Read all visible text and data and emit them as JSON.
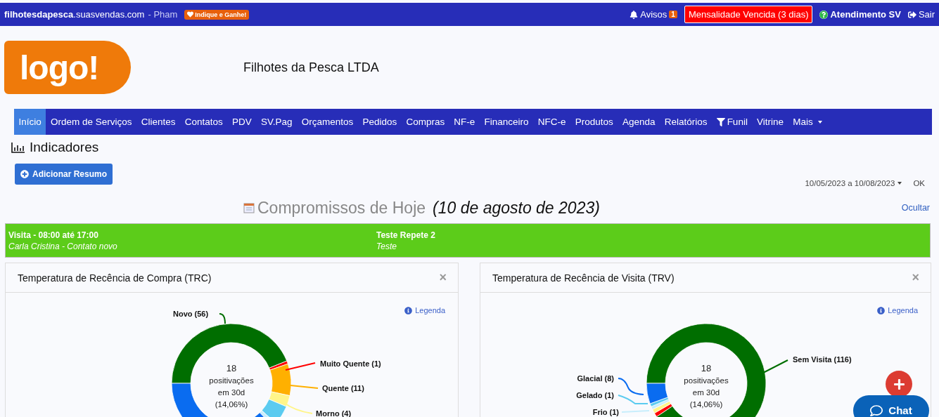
{
  "top_bar": {
    "site": "**filhotesdapesca**.suasvendas.com",
    "user": "- Pham",
    "promo": "Indique e Ganhe!",
    "alerts": {
      "label": "Avisos",
      "count": "1"
    },
    "overdue": "Mensalidade Vencida (3 dias)",
    "support": "Atendimento SV",
    "logout": "Sair"
  },
  "header": {
    "logo": "logo!",
    "company": "Filhotes da Pesca LTDA"
  },
  "nav": [
    {
      "label": "Início",
      "selected": true
    },
    {
      "label": "Ordem de Serviços",
      "selected": false
    },
    {
      "label": "Clientes",
      "selected": false
    },
    {
      "label": "Contatos",
      "selected": false
    },
    {
      "label": "PDV",
      "selected": false
    },
    {
      "label": "SV.Pag",
      "selected": false
    },
    {
      "label": "Orçamentos",
      "selected": false
    },
    {
      "label": "Pedidos",
      "selected": false
    },
    {
      "label": "Compras",
      "selected": false
    },
    {
      "label": "NF-e",
      "selected": false
    },
    {
      "label": "Financeiro",
      "selected": false
    },
    {
      "label": "NFC-e",
      "selected": false
    },
    {
      "label": "Produtos",
      "selected": false
    },
    {
      "label": "Agenda",
      "selected": false
    },
    {
      "label": "Relatórios",
      "selected": false
    },
    {
      "label": "Funil",
      "selected": false,
      "kind": "funnel"
    },
    {
      "label": "Vitrine",
      "selected": false
    },
    {
      "label": "Mais",
      "selected": false,
      "kind": "dropdown"
    }
  ],
  "page_title": "Indicadores",
  "add_button": "Adicionar Resumo",
  "date_range": "10/05/2023 a 10/08/2023",
  "ok": "OK",
  "appointments": {
    "title": "Compromissos de Hoje",
    "date": "(10 de agosto de 2023)",
    "hide": "Ocultar",
    "items": [
      {
        "title": "Visita - 08:00 até 17:00",
        "subtitle": "Carla Cristina - Contato novo"
      },
      {
        "title": "Teste Repete 2",
        "subtitle": "Teste"
      }
    ]
  },
  "cards": [
    {
      "title": "Temperatura de Recência de Compra (TRC)",
      "legend": "Legenda",
      "close": "×",
      "center": [
        "18",
        "positivações",
        "em 30d",
        "(14,06%)"
      ],
      "kind": "trc",
      "labels": [
        {
          "text": "Novo (56)",
          "color": "#006e00"
        },
        {
          "text": "Muito Quente (1)",
          "color": "#ff0000"
        },
        {
          "text": "Quente (11)",
          "color": "#ffb000"
        },
        {
          "text": "Morno (4)",
          "color": "#fff58a"
        }
      ]
    },
    {
      "title": "Temperatura de Recência de Visita (TRV)",
      "legend": "Legenda",
      "close": "×",
      "center": [
        "18",
        "positivações",
        "em 30d",
        "(14,06%)"
      ],
      "kind": "trv",
      "labels": [
        {
          "text": "Sem Visita (116)",
          "color": "#006e00"
        },
        {
          "text": "Glacial (8)",
          "color": "#0a6cf0"
        },
        {
          "text": "Gelado (1)",
          "color": "#5bcbf0"
        },
        {
          "text": "Frio (1)",
          "color": "#c8eefc"
        }
      ]
    }
  ],
  "chat": "Chat"
}
